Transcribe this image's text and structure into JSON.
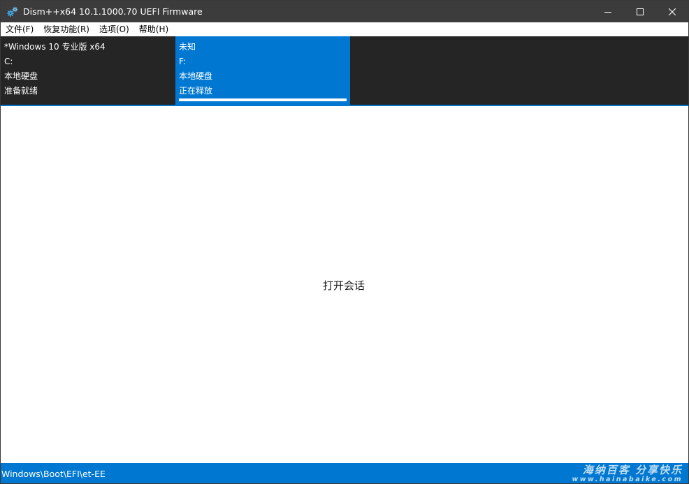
{
  "window": {
    "title": "Dism++x64 10.1.1000.70 UEFI Firmware",
    "icon": "gear-icon"
  },
  "menu": {
    "items": [
      {
        "label": "文件(F)"
      },
      {
        "label": "恢复功能(R)"
      },
      {
        "label": "选项(O)"
      },
      {
        "label": "帮助(H)"
      }
    ]
  },
  "sessions": [
    {
      "name": "*Windows 10 专业版 x64",
      "drive": "C:",
      "disk_type": "本地硬盘",
      "status": "准备就绪",
      "active": false
    },
    {
      "name": "未知",
      "drive": "F:",
      "disk_type": "本地硬盘",
      "status": "正在释放",
      "active": true,
      "progress_percent": 100
    }
  ],
  "main": {
    "open_session_label": "打开会话"
  },
  "statusbar": {
    "path": "Windows\\Boot\\EFI\\et-EE",
    "watermark_main": "海纳百客 分享快乐",
    "watermark_sub": "www.hainabaike.com"
  },
  "colors": {
    "titlebar": "#3c3c3c",
    "session_panel": "#252526",
    "accent": "#0078d2",
    "background": "#ffffff"
  }
}
